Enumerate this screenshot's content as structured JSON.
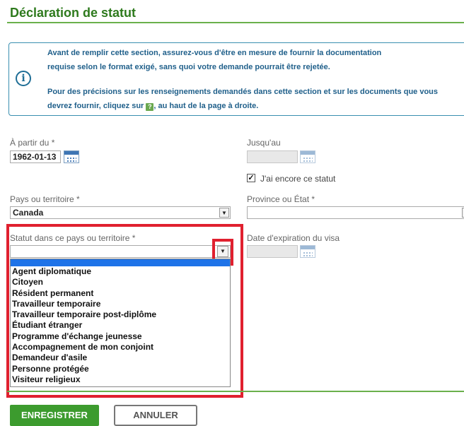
{
  "page": {
    "title": "Déclaration de statut"
  },
  "info": {
    "line1": "Avant de remplir cette section, assurez-vous d'être en mesure de fournir la documentation",
    "line2": "requise selon le format exigé, sans quoi votre demande pourrait être rejetée.",
    "line3": "Pour des précisions sur les renseignements demandés dans cette section et sur les documents que vous",
    "line4_before": "devrez fournir, cliquez sur",
    "line4_after": ", au haut de la page à droite.",
    "help_icon": "?"
  },
  "form": {
    "from_label": "À partir du *",
    "from_value": "1962-01-13",
    "to_label": "Jusqu'au",
    "to_value": "",
    "still_status_label": "J'ai encore ce statut",
    "still_status_checked": true,
    "country_label": "Pays ou territoire *",
    "country_value": "Canada",
    "province_label": "Province ou État *",
    "province_value": "",
    "status_label": "Statut dans ce pays ou territoire *",
    "status_value": "",
    "visa_label": "Date d'expiration du visa",
    "visa_value": ""
  },
  "dropdown": {
    "options": [
      "Agent diplomatique",
      "Citoyen",
      "Résident permanent",
      "Travailleur temporaire",
      "Travailleur temporaire post-diplôme",
      "Étudiant étranger",
      "Programme d'échange jeunesse",
      "Accompagnement de mon conjoint",
      "Demandeur d'asile",
      "Personne protégée",
      "Visiteur religieux"
    ]
  },
  "buttons": {
    "save": "ENREGISTRER",
    "cancel": "ANNULER"
  },
  "colors": {
    "title_green": "#2e7a1d",
    "info_blue": "#1f5f8a",
    "highlight_red": "#e0202f",
    "button_green": "#3c9b2e",
    "selection_blue": "#1e73e8"
  },
  "icons": {
    "info": "info-circle-icon",
    "calendar": "calendar-icon",
    "dropdown_arrow": "chevron-down-icon",
    "checkbox": "checkmark-icon",
    "help": "help-question-icon"
  }
}
